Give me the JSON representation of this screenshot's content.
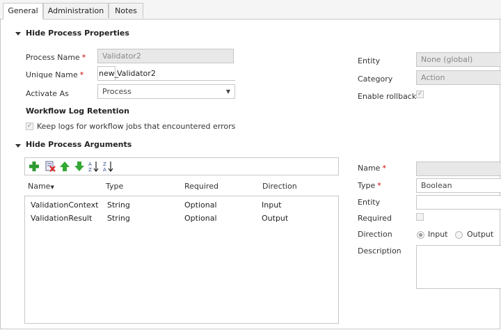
{
  "tabs": [
    "General",
    "Administration",
    "Notes"
  ],
  "process_properties": {
    "section_title": "Hide Process Properties",
    "process_name": {
      "label": "Process Name",
      "value": "Validator2"
    },
    "unique_name": {
      "label": "Unique Name",
      "prefix": "new_",
      "value": "Validator2"
    },
    "activate_as": {
      "label": "Activate As",
      "value": "Process"
    },
    "log_retention_title": "Workflow Log Retention",
    "keep_logs_label": "Keep logs for workflow jobs that encountered errors",
    "entity": {
      "label": "Entity",
      "value": "None (global)"
    },
    "category": {
      "label": "Category",
      "value": "Action"
    },
    "enable_rollback": {
      "label": "Enable rollback"
    }
  },
  "process_arguments": {
    "section_title": "Hide Process Arguments",
    "columns": [
      "Name",
      "Type",
      "Required",
      "Direction"
    ],
    "rows": [
      {
        "name": "ValidationContext",
        "type": "String",
        "required": "Optional",
        "direction": "Input"
      },
      {
        "name": "ValidationResult",
        "type": "String",
        "required": "Optional",
        "direction": "Output"
      }
    ]
  },
  "argument_detail": {
    "name_label": "Name",
    "type_label": "Type",
    "type_value": "Boolean",
    "entity_label": "Entity",
    "required_label": "Required",
    "direction_label": "Direction",
    "direction_input": "Input",
    "direction_output": "Output",
    "description_label": "Description"
  },
  "colors": {
    "required_star": "#cc0000",
    "border": "#c8c8c8",
    "disabled_bg": "#e8e8e8"
  }
}
